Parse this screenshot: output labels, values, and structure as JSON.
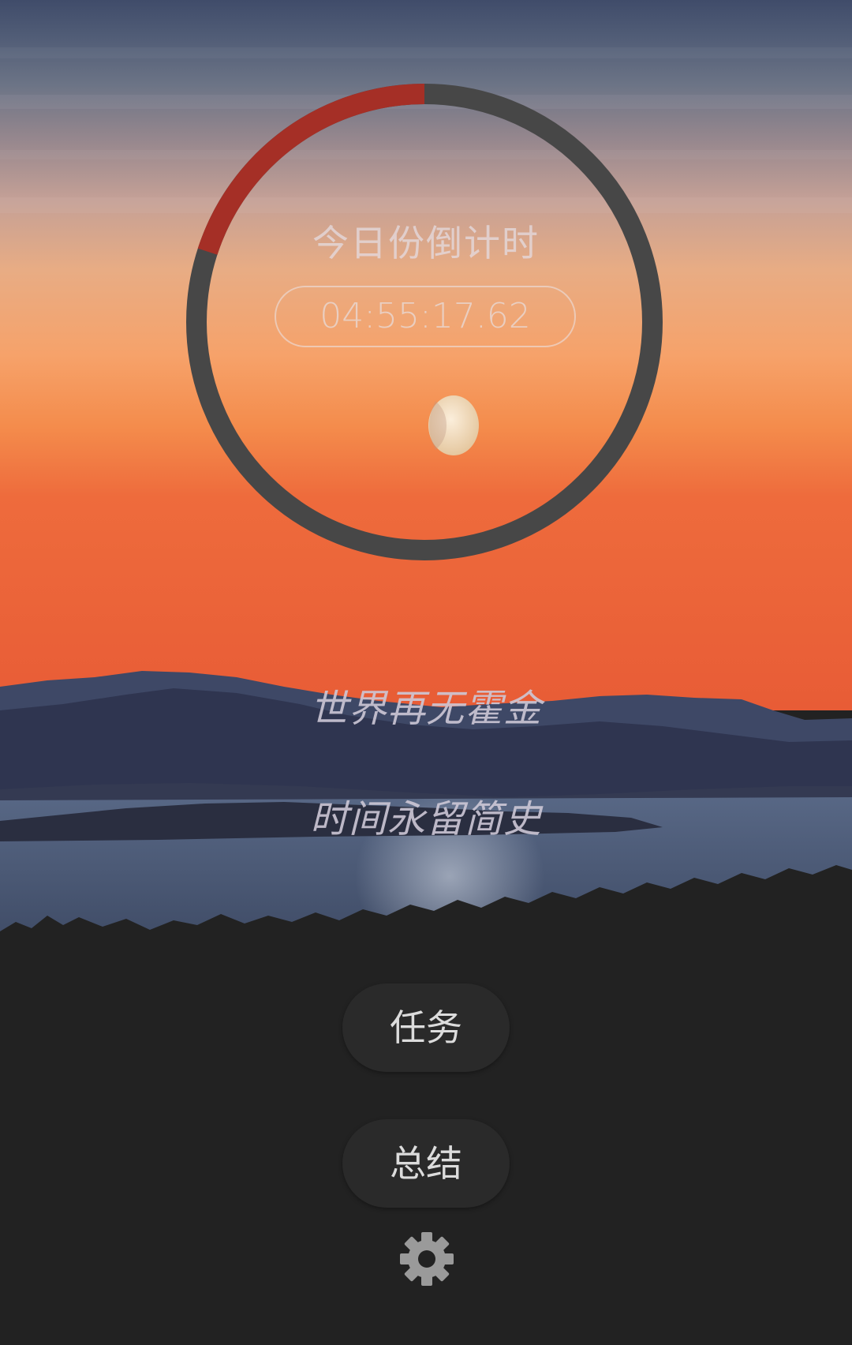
{
  "countdown": {
    "title": "今日份倒计时",
    "time": "04:55:17.62",
    "progress_fraction": 0.2
  },
  "quotes": {
    "line1": "世界再无霍金",
    "line2": "时间永留简史"
  },
  "menu": {
    "tasks_label": "任务",
    "summary_label": "总结"
  },
  "icons": {
    "settings": "gear-icon",
    "moon": "moon-image"
  },
  "colors": {
    "ring_track": "#474747",
    "ring_progress": "#a52f26",
    "button_bg": "#2a2a2a",
    "button_text": "#dcdcdc"
  }
}
